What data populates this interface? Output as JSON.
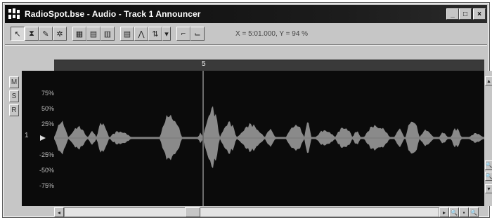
{
  "window": {
    "title": "RadioSpot.bse - Audio - Track 1 Announcer",
    "controls": [
      "_",
      "□",
      "×"
    ]
  },
  "toolbar": {
    "tools": [
      {
        "name": "select-tool",
        "icon": "arrow-icon",
        "glyph": "↖",
        "pressed": true
      },
      {
        "name": "zoom-tool",
        "icon": "figure-icon",
        "glyph": "⧗",
        "pressed": false
      },
      {
        "name": "pencil-tool",
        "icon": "pencil-icon",
        "glyph": "✎",
        "pressed": false
      },
      {
        "name": "scrub-tool",
        "icon": "gear-icon",
        "glyph": "✲",
        "pressed": false
      },
      {
        "name": "view-tool-1",
        "icon": "grid-icon",
        "glyph": "▦",
        "pressed": false
      },
      {
        "name": "view-tool-2",
        "icon": "waveform-icon",
        "glyph": "▤",
        "pressed": false
      },
      {
        "name": "view-tool-3",
        "icon": "stacked-icon",
        "glyph": "▥",
        "pressed": false
      },
      {
        "name": "snap-tool",
        "icon": "snap-icon",
        "glyph": "▤",
        "pressed": false
      },
      {
        "name": "edit-tool",
        "icon": "edit-icon",
        "glyph": "⋀",
        "pressed": false
      },
      {
        "name": "dropdown-tool",
        "icon": "dropdown-icon",
        "glyph": "⇅",
        "pressed": false
      },
      {
        "name": "dropdown-arrow",
        "icon": "chevron-down-icon",
        "glyph": "▾",
        "pressed": false
      },
      {
        "name": "envelope-tool-1",
        "icon": "envelope-icon",
        "glyph": "⌐",
        "pressed": false
      },
      {
        "name": "envelope-tool-2",
        "icon": "envelope-alt-icon",
        "glyph": "⌙",
        "pressed": false
      }
    ],
    "coordinates": "X = 5:01.000, Y = 94 %"
  },
  "track": {
    "side_buttons": [
      "M",
      "S",
      "R"
    ],
    "number": "1",
    "ruler_marker": "5"
  },
  "waveform": {
    "axis_labels": [
      "75%",
      "50%",
      "25%",
      "-25%",
      "-50%",
      "-75%"
    ],
    "colors": {
      "background": "#0b0b0b",
      "wave": "#8a8a8a",
      "cursor": "#6b6b6b"
    }
  },
  "scroll": {
    "vertical_buttons": [
      "▴",
      "🔍",
      "🔍",
      "▾"
    ],
    "left_arrow": "◂",
    "right_arrow": "▸",
    "zoom_buttons": [
      "🔍",
      "▪",
      "🔍"
    ]
  }
}
